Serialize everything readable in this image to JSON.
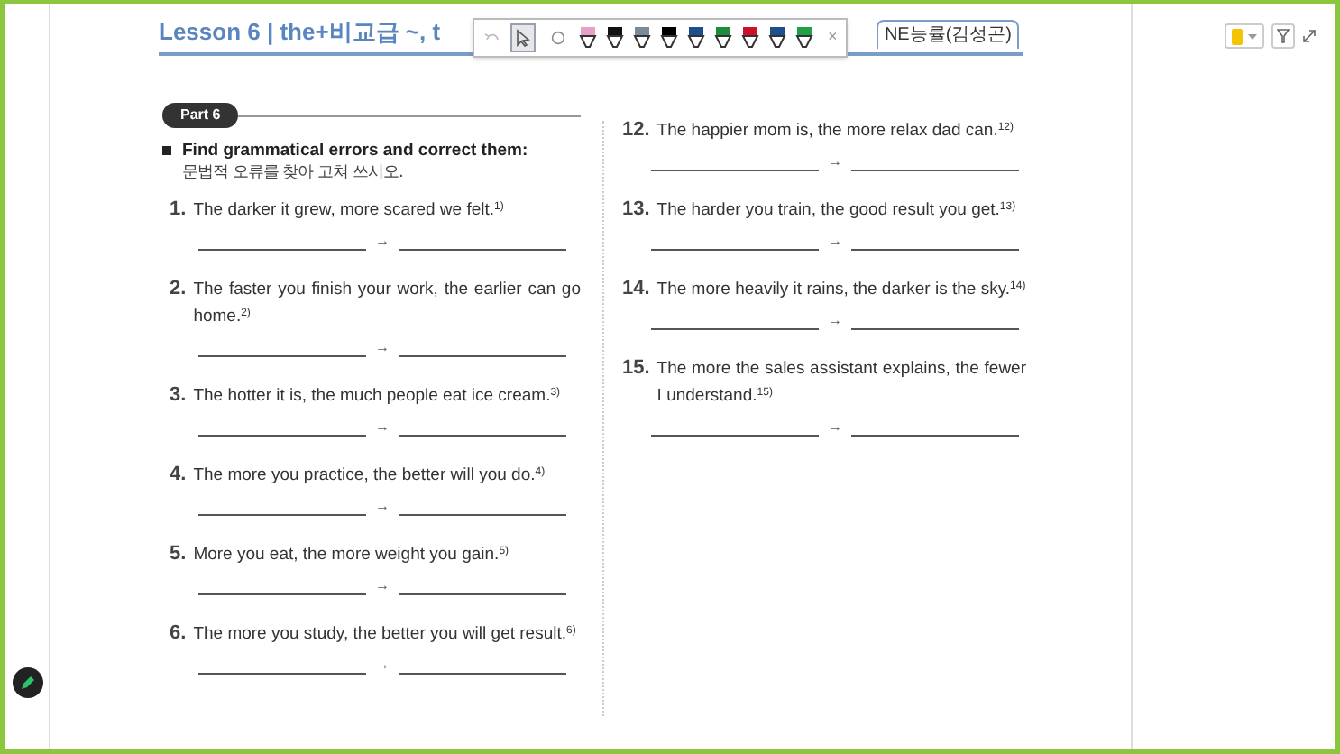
{
  "header": {
    "title": "Lesson 6 | the+비교급 ~, t",
    "publisher": "NE능률(김성곤)"
  },
  "toolbar": {
    "tools": [
      {
        "kind": "select",
        "selected": true
      },
      {
        "kind": "lasso",
        "selected": false
      }
    ],
    "pens": [
      {
        "color": "#e8a0c8",
        "selected": false
      },
      {
        "color": "#111111",
        "selected": false
      },
      {
        "color": "#7a8a96",
        "selected": false
      },
      {
        "color": "#000000",
        "selected": false
      },
      {
        "color": "#1f4e8c",
        "selected": false
      },
      {
        "color": "#1e8c3a",
        "selected": false
      },
      {
        "color": "#d0102a",
        "selected": false
      },
      {
        "color": "#1f4e8c",
        "selected": false
      },
      {
        "color": "#22a046",
        "selected": false
      }
    ],
    "close": "×"
  },
  "part": "Part 6",
  "instruction": {
    "english": "Find grammatical errors and correct them:",
    "korean": "문법적 오류를 찾아 고쳐 쓰시오."
  },
  "columns": [
    [
      {
        "number": "1.",
        "text": "The darker it grew, more scared we felt.$^{1)}$",
        "arrow": "→"
      },
      {
        "number": "2.",
        "text": "The faster you finish your work, the earlier can go home.$^{2)}$",
        "arrow": "→"
      },
      {
        "number": "3.",
        "text": "The hotter it is, the much people eat ice cream.$^{3)}$",
        "arrow": "→"
      },
      {
        "number": "4.",
        "text": "The more you practice, the better will you do.$^{4)}$",
        "arrow": "→"
      },
      {
        "number": "5.",
        "text": "More you eat, the more weight you gain.$^{5)}$",
        "arrow": "→"
      },
      {
        "number": "6.",
        "text": "The more you study, the better you will get result.$^{6)}$",
        "arrow": "→"
      }
    ],
    [
      {
        "number": "12.",
        "text": "The happier mom is, the more relax dad can.$^{12)}$",
        "arrow": "→"
      },
      {
        "number": "13.",
        "text": "The harder you train, the good result you get.$^{13)}$",
        "arrow": "→"
      },
      {
        "number": "14.",
        "text": "The more heavily it rains, the darker is the sky.$^{14)}$",
        "arrow": "→"
      },
      {
        "number": "15.",
        "text": "The more the sales assistant explains, the fewer I understand.$^{15)}$",
        "arrow": "→"
      }
    ]
  ]
}
